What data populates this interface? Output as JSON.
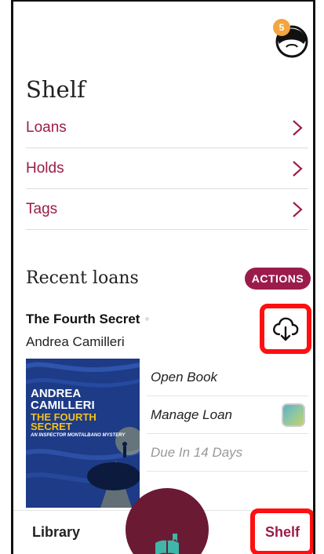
{
  "header": {
    "badge_count": "5",
    "title": "Shelf"
  },
  "nav": [
    {
      "label": "Loans"
    },
    {
      "label": "Holds"
    },
    {
      "label": "Tags"
    }
  ],
  "recent": {
    "title": "Recent loans",
    "actions_label": "ACTIONS",
    "book": {
      "title": "The Fourth Secret",
      "author": "Andrea Camilleri",
      "cover_author": "ANDREA\nCAMILLERI",
      "cover_title": "THE FOURTH\nSECRET",
      "cover_subtitle": "AN INSPECTOR MONTALBANO MYSTERY"
    },
    "book_actions": [
      {
        "label": "Open Book"
      },
      {
        "label": "Manage Loan"
      },
      {
        "label": "Due In 14 Days"
      }
    ]
  },
  "bottom_nav": {
    "library_label": "Library",
    "shelf_label": "Shelf"
  },
  "icons": {
    "avatar": "avatar-icon",
    "chevron": "chevron-right-icon",
    "download": "cloud-download-icon",
    "cover_art": "book-cover",
    "fab": "open-book-icon"
  },
  "colors": {
    "accent": "#9b1c4a",
    "fab": "#6b1a34",
    "badge": "#f2a541",
    "highlight": "#ff0f0f",
    "cover": "#1f3f8a"
  }
}
